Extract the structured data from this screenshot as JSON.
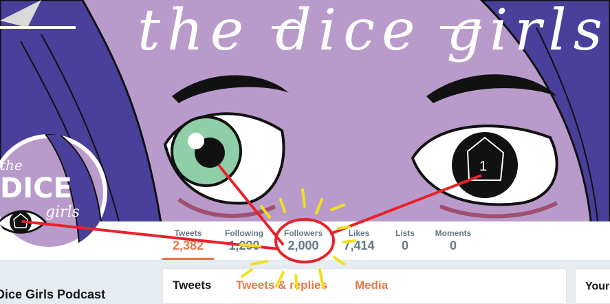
{
  "banner": {
    "script_title": "the dice girls"
  },
  "avatar": {
    "logo_text_the": "the",
    "logo_text_dice": "DICE",
    "logo_text_girls": "girls"
  },
  "profile": {
    "name": "Dice Girls Podcast"
  },
  "stats": [
    {
      "label": "Tweets",
      "value": "2,382"
    },
    {
      "label": "Following",
      "value": "1,290"
    },
    {
      "label": "Followers",
      "value": "2,000"
    },
    {
      "label": "Likes",
      "value": "7,414"
    },
    {
      "label": "Lists",
      "value": "0"
    },
    {
      "label": "Moments",
      "value": "0"
    }
  ],
  "timeline_tabs": [
    "Tweets",
    "Tweets & replies",
    "Media"
  ],
  "side_card": {
    "title": "Your"
  },
  "colors": {
    "accent": "#e8784a",
    "banner_purple": "#b99bcb",
    "hair_indigo": "#4a3f9a",
    "annotation_red": "#e8212a",
    "annotation_yellow": "#f2e01a"
  }
}
